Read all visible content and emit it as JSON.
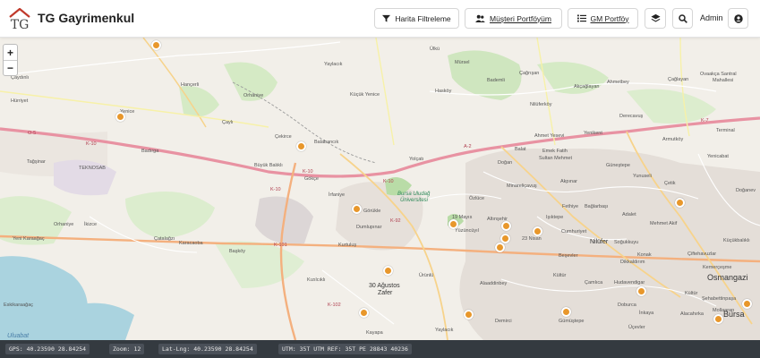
{
  "header": {
    "brand": "TG Gayrimenkul",
    "logo_letters": "TG",
    "btn_filter": "Harita Filtreleme",
    "btn_portfolio": "Müşteri Portföyüm",
    "btn_gm": "GM Portföy",
    "user": "Admin"
  },
  "map": {
    "zoom_in": "+",
    "zoom_out": "−",
    "labels": {
      "caydinli": "Çaydınlı",
      "hancerli": "Hançerli",
      "orhaniye": "Orhaniye",
      "yaylacik": "Yaylacık",
      "kucukyenice": "Küçük Yenice",
      "hasköy": "Hasköy",
      "ulku": "Ülkü",
      "mursel": "Mürsel",
      "bademli": "Bademli",
      "cagrisan": "Çağrışan",
      "akcaglayan": "Akçağlayan",
      "ahmetbey": "Ahmetbey",
      "caglayan": "Çağlayan",
      "ovaakca": "Ovaakça Santral",
      "mahallesi": "Mahallesi",
      "hurriyet": "Hürriyet",
      "yeniyenice": "Yenice",
      "cayli": "Çaylı",
      "cekirce": "Çekirce",
      "balabancik": "Balabancık",
      "niluferkoy": "Nilüferköy",
      "derecavus": "Derecavuş",
      "tagsinar": "Tağşinar",
      "teknosab": "TEKNOSAB",
      "badirga": "Badırga",
      "buyukbalikli": "Büyük Balıklı",
      "yolcati": "Yolçatı",
      "balat": "Balat",
      "ahmetyesevi": "Ahmet Yesevi",
      "emekfatih": "Emek Fatih",
      "sultanmehmet": "Sultan Mehmet",
      "yenikent": "Yenikent",
      "armutkoy": "Armutköy",
      "terminal": "Terminal",
      "yenicabat": "Yenicabat",
      "gunestepe": "Güneştepe",
      "dogan": "Doğan",
      "gokce": "Gökçe",
      "irfaniye": "İrfaniye",
      "bursauludag": "Bursa Uludağ",
      "universitesi": "Üniversitesi",
      "ozluce": "Özlüce",
      "minareli": "Minareliçavuş",
      "akpinar": "Akpınar",
      "yunuseli": "Yunuseli",
      "cetik": "Çetik",
      "dogan2": "Doğanev",
      "gorukle": "Görükle",
      "fethiye": "Fethiye",
      "isiktepe": "Işıktepe",
      "baglarbasi": "Bağlarbaşı",
      "adalet": "Adalet",
      "mehmetakif": "Mehmet Akif",
      "orhaniye2": "Orhaniye",
      "ikizce": "İkizce",
      "dumlupinar": "Dumlupınar",
      "mayis19": "19 Mayıs",
      "altinsehir": "Altınşehir",
      "yuzuncuyil": "Yüzüncüyıl",
      "nisan23": "23 Nisan",
      "cumhuriyet": "Cumhuriyet",
      "nilufer": "Nilüfer",
      "sogukkuyu": "Soğukkuyu",
      "kucukbalikli": "Küçükbalıklı",
      "yenikaraagac": "Yeni Karaağaç",
      "catalagzi": "Çatalağzı",
      "karacaoba": "Karacaoba",
      "kurtulus": "Kurtuluş",
      "cifteler": "Çiftehavuzlar",
      "kemercesme": "Kemerçeşme",
      "baskoy": "Başköy",
      "besevler": "Beşevler",
      "konak": "Konak",
      "dikkaldirim": "Dikkaldırım",
      "osmangazi": "Osmangazi",
      "kizilcikli": "Kızılcıklı",
      "agustos30": "30 Ağustos",
      "zafer": "Zafer",
      "urunlu": "Ürünlü",
      "kultur": "Kültür",
      "camlica": "Çamlıca",
      "hudavendigar": "Hudavendigar",
      "sehabettin": "Şehabettinpaşa",
      "eskikaraagac": "Eskikaraağaç",
      "alaaddinbey": "Alaaddinbey",
      "doburca": "Doburca",
      "inkaya": "İnkaya",
      "alacahirka": "Alacahırka",
      "mollaarap": "Mollaarap",
      "bursa": "Bursa",
      "demirci": "Demirci",
      "gumustepe": "Gümüştepe",
      "uluabat": "Uluabat",
      "kayapa": "Kayapa",
      "yaylacik2": "Yaylacık",
      "ucevler": "Üçevler",
      "kultur2": "Kültür",
      "o5": "O-5",
      "k10a": "K-10",
      "k10b": "K-10",
      "k10c": "K-10",
      "k101": "K-101",
      "k102": "K-102",
      "a2": "A-2",
      "k92": "K-92",
      "k7": "K-7",
      "k10d": "K-10"
    }
  },
  "status": {
    "gps": "GPS: 40.23590 28.84254",
    "zoom": "Zoom: 12",
    "latlng": "Lat-Lng: 40.23590 28.84254",
    "utm": "UTM: 35T UTM REF: 35T PE 28843 40236"
  }
}
